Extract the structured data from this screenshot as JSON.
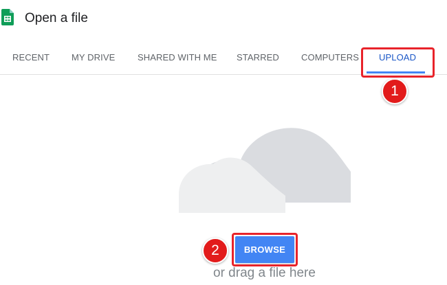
{
  "header": {
    "app_icon": "google-sheets-icon",
    "title": "Open a file"
  },
  "tabs": [
    {
      "label": "RECENT",
      "active": false
    },
    {
      "label": "MY DRIVE",
      "active": false
    },
    {
      "label": "SHARED WITH ME",
      "active": false
    },
    {
      "label": "STARRED",
      "active": false
    },
    {
      "label": "COMPUTERS",
      "active": false
    },
    {
      "label": "UPLOAD",
      "active": true
    }
  ],
  "upload": {
    "illustration": "cloud-icon",
    "browse_label": "BROWSE",
    "drag_text": "or drag a file here"
  },
  "annotations": [
    {
      "number": "1",
      "target": "UPLOAD"
    },
    {
      "number": "2",
      "target": "BROWSE"
    }
  ],
  "colors": {
    "accent": "#4285f4",
    "active_tab_text": "#1a57c7",
    "annotation_red": "#e21b1b",
    "sheets_green": "#0f9d58"
  }
}
